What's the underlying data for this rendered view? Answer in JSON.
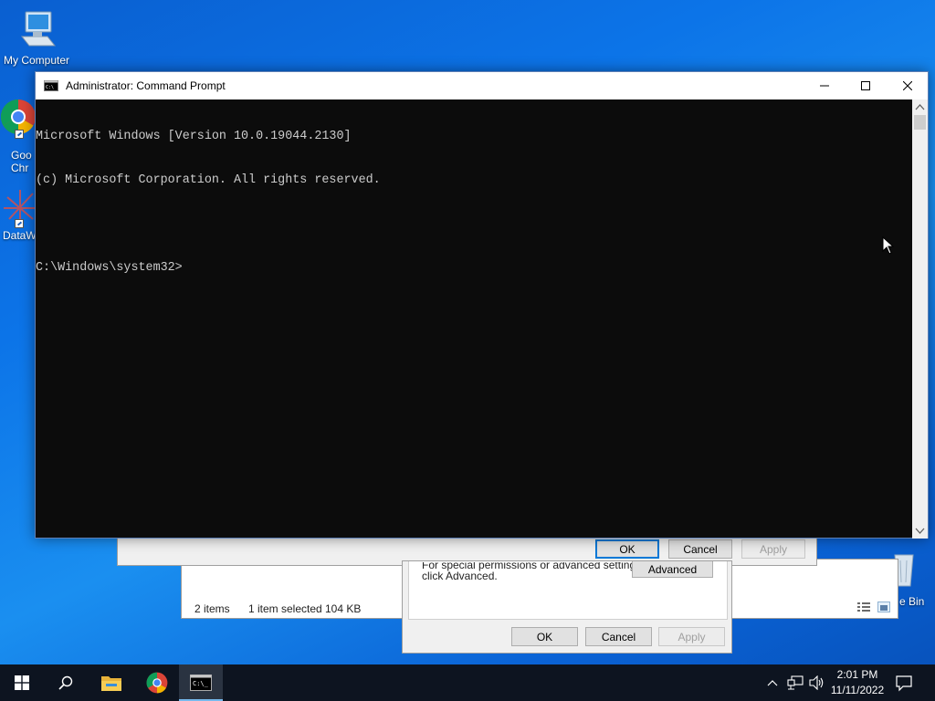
{
  "desktop": {
    "icons": [
      {
        "label": "My Computer"
      },
      {
        "label": "Goo"
      },
      {
        "label": "Chr"
      },
      {
        "label": "DataW"
      },
      {
        "label": "e Bin"
      }
    ]
  },
  "explorer_window": {
    "status_items": "2 items",
    "status_selected": "1 item selected",
    "status_size": "104 KB"
  },
  "properties_dialog": {
    "ok": "OK",
    "cancel": "Cancel",
    "apply": "Apply"
  },
  "security_dialog": {
    "hint_line1": "For special permissions or advanced settings,",
    "hint_line2": "click Advanced.",
    "advanced": "Advanced",
    "ok": "OK",
    "cancel": "Cancel",
    "apply": "Apply"
  },
  "cmd": {
    "title": "Administrator: Command Prompt",
    "lines": [
      "Microsoft Windows [Version 10.0.19044.2130]",
      "(c) Microsoft Corporation. All rights reserved.",
      "",
      "C:\\Windows\\system32>"
    ]
  },
  "taskbar": {
    "time": "2:01 PM",
    "date": "11/11/2022",
    "icons": [
      "windows-start-icon",
      "search-icon",
      "file-explorer-icon",
      "chrome-icon",
      "command-prompt-icon"
    ]
  },
  "colors": {
    "desktop_blue": "#0c74e8",
    "console_bg": "#0c0c0c",
    "console_text": "#cccccc",
    "taskbar_bg": "#0d1420",
    "accent": "#0078d7"
  }
}
